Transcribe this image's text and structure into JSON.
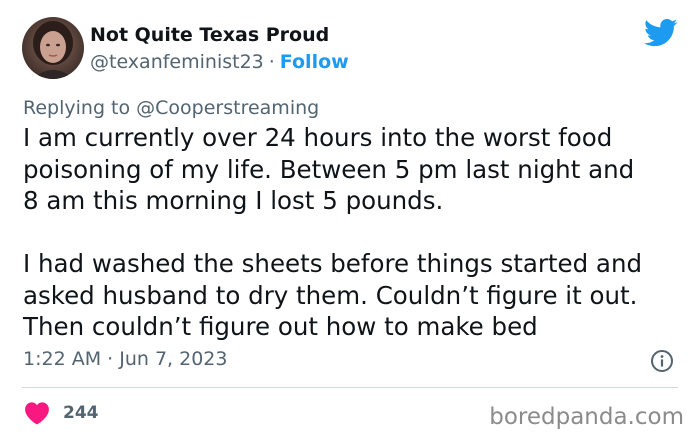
{
  "tweet": {
    "author": {
      "display_name": "Not Quite Texas Proud",
      "handle": "@texanfeminist23",
      "separator": "·",
      "follow_label": "Follow",
      "avatar_icon": "user-avatar"
    },
    "replying_to": "Replying to @Cooperstreaming",
    "body_lines": [
      "I am currently over 24 hours into the worst food",
      "poisoning of my life. Between 5 pm last night and",
      "8 am this morning I lost 5 pounds.",
      "",
      "I had washed the sheets before things started and",
      "asked husband to dry them. Couldn’t figure it out.",
      "Then couldn’t figure out how to make bed"
    ],
    "timestamp": "1:22 AM · Jun 7, 2023",
    "likes": "244",
    "brand_icon": "twitter-bird-icon",
    "info_icon": "info-icon",
    "like_icon": "heart-icon"
  },
  "watermark": "boredpanda.com",
  "colors": {
    "brand_blue": "#1d9bf0",
    "text_primary": "#0f1419",
    "text_secondary": "#536471",
    "heart_red": "#f91880",
    "divider": "#cfd9de",
    "watermark": "#8b8b8b"
  }
}
